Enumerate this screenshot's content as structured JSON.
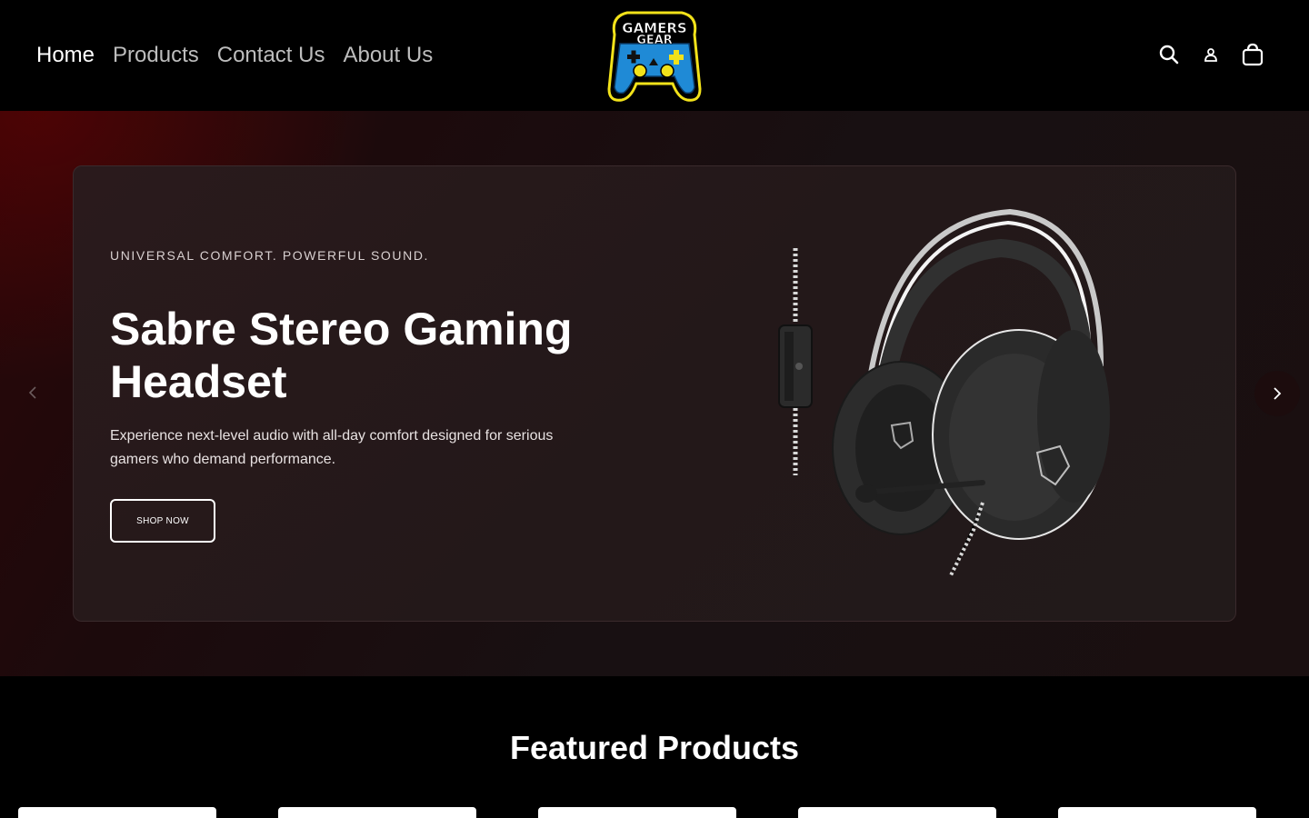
{
  "header": {
    "nav": [
      {
        "label": "Home",
        "active": true
      },
      {
        "label": "Products",
        "active": false
      },
      {
        "label": "Contact Us",
        "active": false
      },
      {
        "label": "About Us",
        "active": false
      }
    ],
    "logo_text": "GAMERSGEAR",
    "icons": [
      "search-icon",
      "account-icon",
      "cart-icon"
    ]
  },
  "hero": {
    "eyebrow": "UNIVERSAL COMFORT. POWERFUL SOUND.",
    "title": "Sabre Stereo Gaming Headset",
    "description": "Experience next-level audio with all-day comfort designed for serious gamers who demand performance.",
    "button_label": "SHOP NOW"
  },
  "featured": {
    "title": "Featured Products",
    "cards": 5
  },
  "colors": {
    "background": "#000000",
    "hero_accent": "#2a0608",
    "logo_yellow": "#f2e21a",
    "logo_blue": "#1f8ad6"
  }
}
